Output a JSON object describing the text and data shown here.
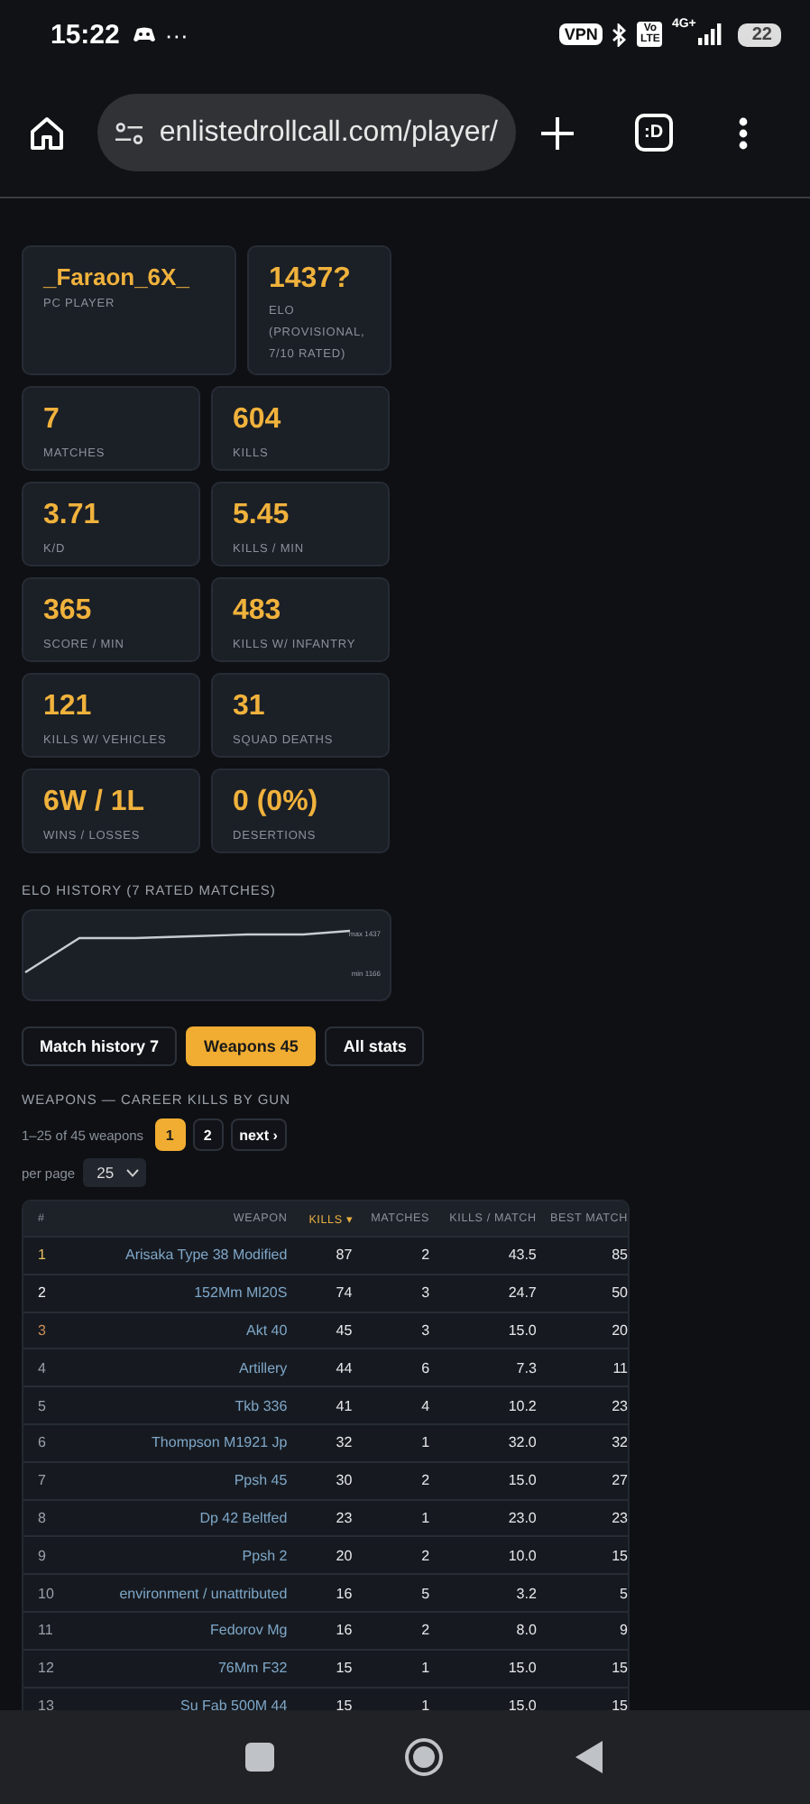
{
  "status_bar": {
    "time": "15:22",
    "more": "···",
    "vpn": "VPN",
    "volte": "Vo LTE",
    "network": "4G+",
    "battery": "22"
  },
  "browser": {
    "url": "enlistedrollcall.com/player/",
    "tab_label": ":D"
  },
  "player": {
    "name": "_Faraon_6X_",
    "platform": "PC PLAYER",
    "elo": "1437?",
    "elo_label": "ELO (PROVISIONAL, 7/10 RATED)"
  },
  "stats": [
    {
      "value": "7",
      "label": "MATCHES"
    },
    {
      "value": "604",
      "label": "KILLS"
    },
    {
      "value": "3.71",
      "label": "K/D"
    },
    {
      "value": "5.45",
      "label": "KILLS / MIN"
    },
    {
      "value": "365",
      "label": "SCORE / MIN"
    },
    {
      "value": "483",
      "label": "KILLS W/ INFANTRY"
    },
    {
      "value": "121",
      "label": "KILLS W/ VEHICLES"
    },
    {
      "value": "31",
      "label": "SQUAD DEATHS"
    },
    {
      "value": "6W / 1L",
      "label": "WINS / LOSSES"
    },
    {
      "value": "0 (0%)",
      "label": "DESERTIONS"
    }
  ],
  "elo_history": {
    "title": "ELO HISTORY (7 RATED MATCHES)",
    "max_label": "max 1437",
    "min_label": "min 1166"
  },
  "tabs": [
    {
      "label": "Match history 7",
      "selected": false
    },
    {
      "label": "Weapons 45",
      "selected": true
    },
    {
      "label": "All stats",
      "selected": false
    }
  ],
  "weapons": {
    "title": "WEAPONS — CAREER KILLS BY GUN",
    "range": "1–25 of 45 weapons",
    "pages": [
      {
        "label": "1",
        "selected": true
      },
      {
        "label": "2",
        "selected": false
      },
      {
        "label": "next ›",
        "selected": false
      }
    ],
    "per_page_label": "per page",
    "per_page": "25",
    "columns": [
      {
        "label": "#",
        "sorted": false
      },
      {
        "label": "WEAPON",
        "sorted": false
      },
      {
        "label": "KILLS ▾",
        "sorted": true
      },
      {
        "label": "MATCHES",
        "sorted": false
      },
      {
        "label": "KILLS / MATCH",
        "sorted": false
      },
      {
        "label": "BEST MATCH",
        "sorted": false
      }
    ],
    "rows": [
      {
        "rank": "1",
        "color": "#e8c060",
        "weapon": "Arisaka Type 38 Modified",
        "kills": "87",
        "matches": "2",
        "kills_per_match": "43.5",
        "best": "85"
      },
      {
        "rank": "2",
        "color": "#f0f0f0",
        "weapon": "152Mm Ml20S",
        "kills": "74",
        "matches": "3",
        "kills_per_match": "24.7",
        "best": "50"
      },
      {
        "rank": "3",
        "color": "#d0905a",
        "weapon": "Akt 40",
        "kills": "45",
        "matches": "3",
        "kills_per_match": "15.0",
        "best": "20"
      },
      {
        "rank": "4",
        "color": "#9aa0a8",
        "weapon": "Artillery",
        "kills": "44",
        "matches": "6",
        "kills_per_match": "7.3",
        "best": "11"
      },
      {
        "rank": "5",
        "color": "#9aa0a8",
        "weapon": "Tkb 336",
        "kills": "41",
        "matches": "4",
        "kills_per_match": "10.2",
        "best": "23"
      },
      {
        "rank": "6",
        "color": "#9aa0a8",
        "weapon": "Thompson M1921 Jp",
        "kills": "32",
        "matches": "1",
        "kills_per_match": "32.0",
        "best": "32"
      },
      {
        "rank": "7",
        "color": "#9aa0a8",
        "weapon": "Ppsh 45",
        "kills": "30",
        "matches": "2",
        "kills_per_match": "15.0",
        "best": "27"
      },
      {
        "rank": "8",
        "color": "#9aa0a8",
        "weapon": "Dp 42 Beltfed",
        "kills": "23",
        "matches": "1",
        "kills_per_match": "23.0",
        "best": "23"
      },
      {
        "rank": "9",
        "color": "#9aa0a8",
        "weapon": "Ppsh 2",
        "kills": "20",
        "matches": "2",
        "kills_per_match": "10.0",
        "best": "15"
      },
      {
        "rank": "10",
        "color": "#9aa0a8",
        "weapon": "environment / unattributed",
        "kills": "16",
        "matches": "5",
        "kills_per_match": "3.2",
        "best": "5"
      },
      {
        "rank": "11",
        "color": "#9aa0a8",
        "weapon": "Fedorov Mg",
        "kills": "16",
        "matches": "2",
        "kills_per_match": "8.0",
        "best": "9"
      },
      {
        "rank": "12",
        "color": "#9aa0a8",
        "weapon": "76Mm F32",
        "kills": "15",
        "matches": "1",
        "kills_per_match": "15.0",
        "best": "15"
      },
      {
        "rank": "13",
        "color": "#9aa0a8",
        "weapon": "Su Fab 500M 44",
        "kills": "15",
        "matches": "1",
        "kills_per_match": "15.0",
        "best": "15"
      }
    ]
  }
}
